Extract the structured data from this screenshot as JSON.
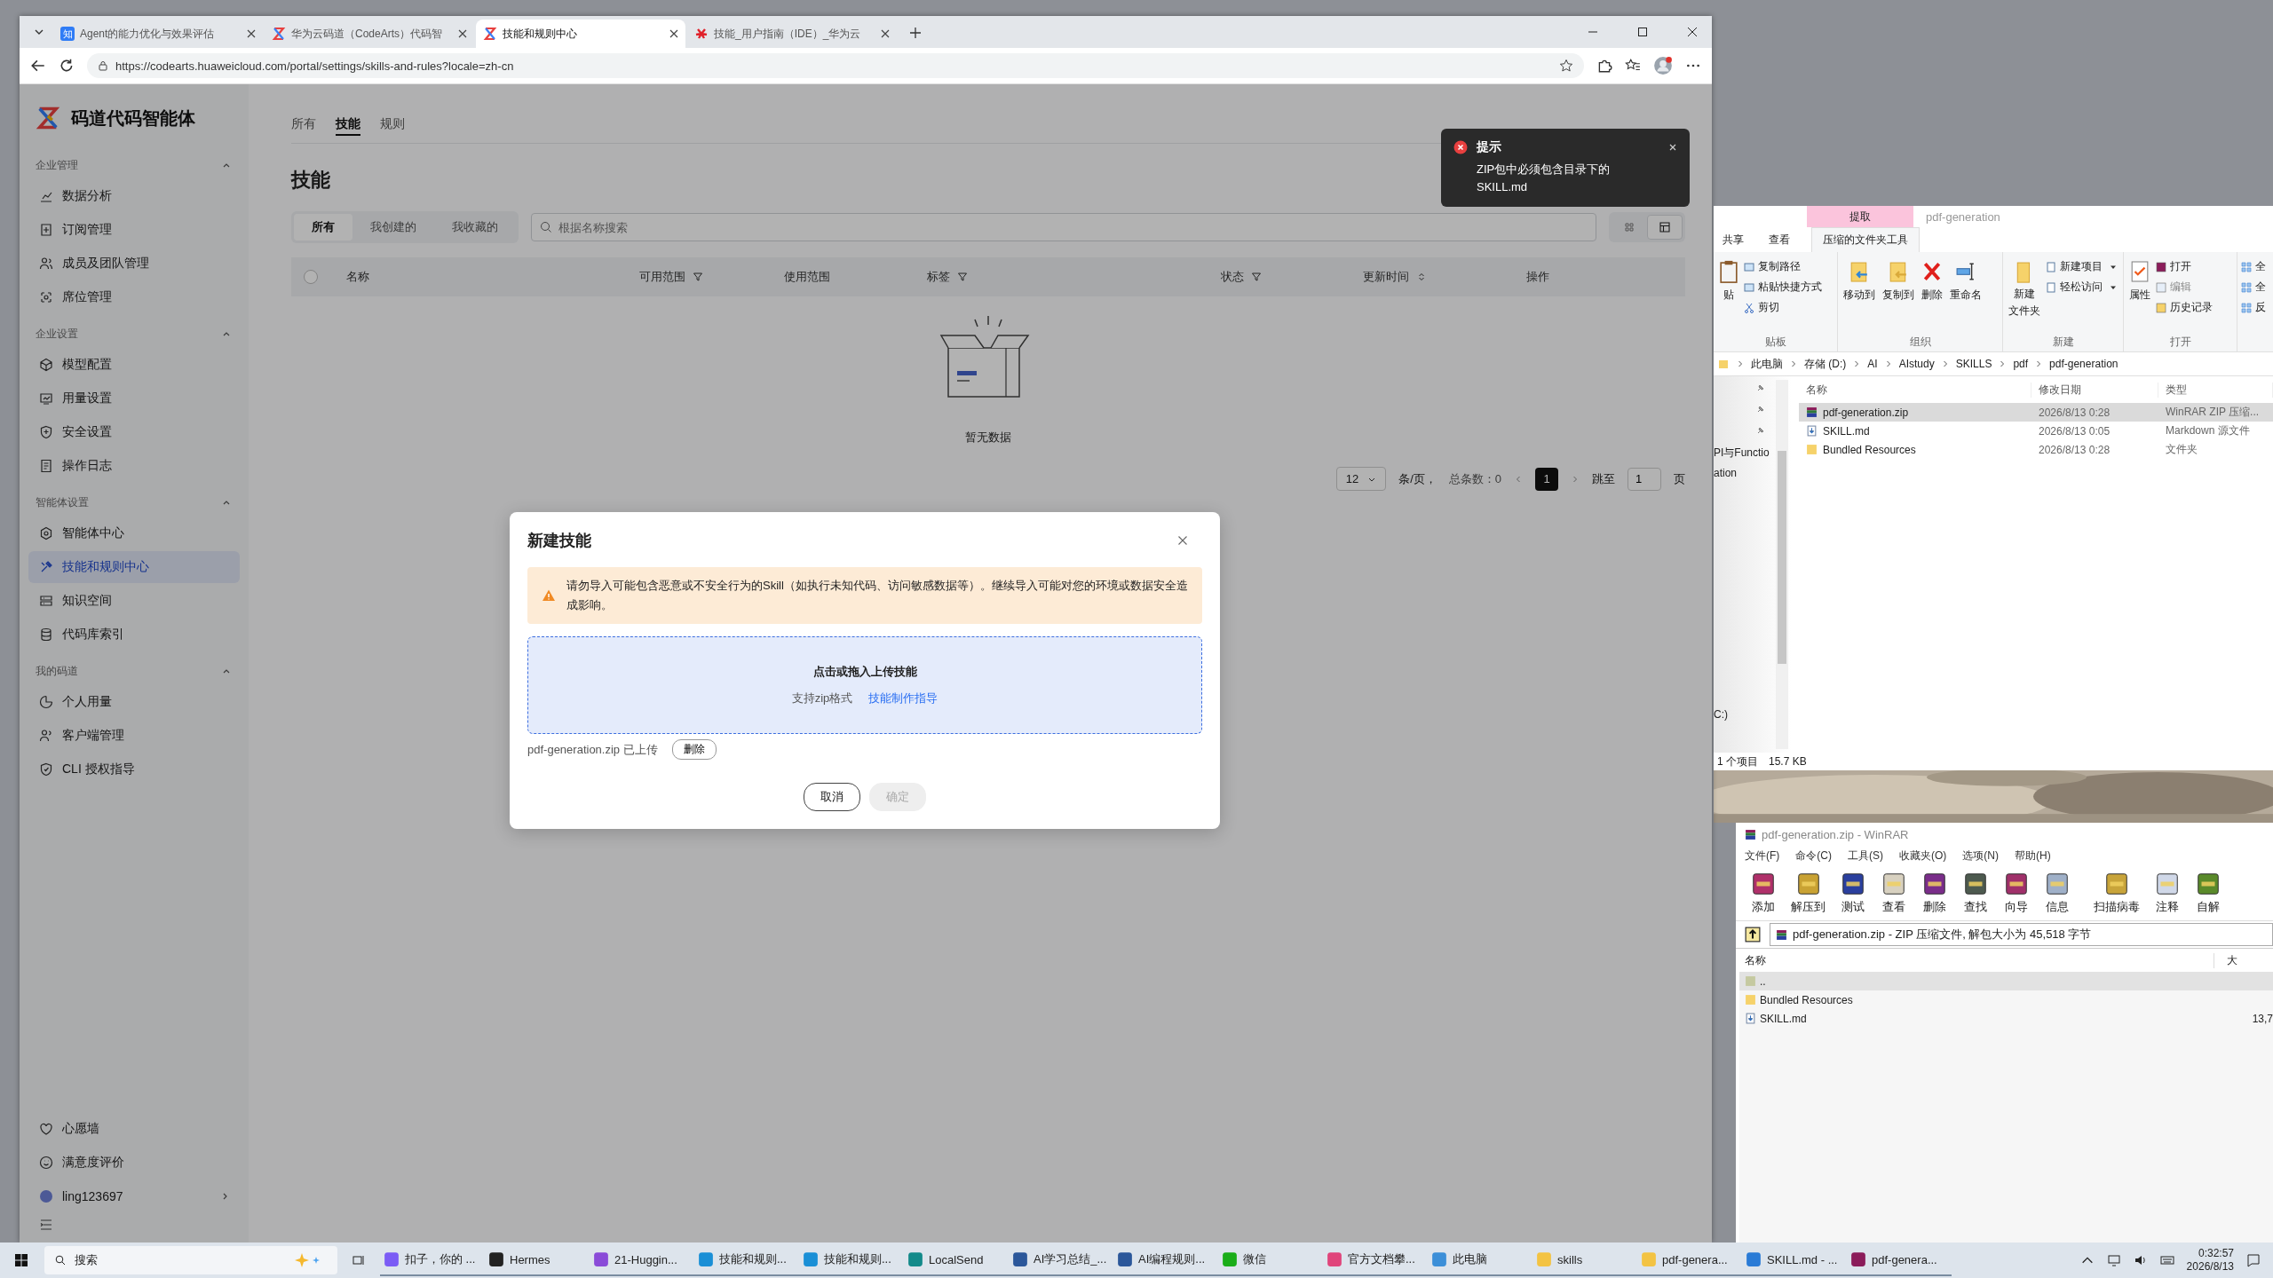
{
  "browser": {
    "tabs": [
      {
        "title": "Agent的能力优化与效果评估",
        "selected": false,
        "kind": "letter",
        "favicon_text": "知"
      },
      {
        "title": "华为云码道（CodeArts）代码智",
        "selected": false,
        "kind": "logo"
      },
      {
        "title": "技能和规则中心",
        "selected": true,
        "kind": "logo"
      },
      {
        "title": "技能_用户指南（IDE）_华为云",
        "selected": false,
        "kind": "flower"
      }
    ],
    "url": "https://codearts.huaweicloud.com/portal/settings/skills-and-rules?locale=zh-cn"
  },
  "sidebar": {
    "brand": "码道代码智能体",
    "sections": [
      {
        "title": "企业管理",
        "expanded": true,
        "items": [
          {
            "label": "数据分析",
            "selected": false
          },
          {
            "label": "订阅管理",
            "selected": false
          },
          {
            "label": "成员及团队管理",
            "selected": false
          },
          {
            "label": "席位管理",
            "selected": false
          }
        ]
      },
      {
        "title": "企业设置",
        "expanded": true,
        "items": [
          {
            "label": "模型配置",
            "selected": false
          },
          {
            "label": "用量设置",
            "selected": false
          },
          {
            "label": "安全设置",
            "selected": false
          },
          {
            "label": "操作日志",
            "selected": false
          }
        ]
      },
      {
        "title": "智能体设置",
        "expanded": true,
        "items": [
          {
            "label": "智能体中心",
            "selected": false
          },
          {
            "label": "技能和规则中心",
            "selected": true
          },
          {
            "label": "知识空间",
            "selected": false
          },
          {
            "label": "代码库索引",
            "selected": false
          }
        ]
      },
      {
        "title": "我的码道",
        "expanded": true,
        "items": [
          {
            "label": "个人用量",
            "selected": false
          },
          {
            "label": "客户端管理",
            "selected": false
          },
          {
            "label": "CLI 授权指导",
            "selected": false
          }
        ]
      }
    ],
    "bottom_items": [
      {
        "label": "心愿墙"
      },
      {
        "label": "满意度评价"
      }
    ],
    "user": {
      "name": "ling123697"
    }
  },
  "main": {
    "tabs": [
      {
        "label": "所有",
        "selected": false
      },
      {
        "label": "技能",
        "selected": true
      },
      {
        "label": "规则",
        "selected": false
      }
    ],
    "title": "技能",
    "filters": [
      {
        "label": "所有",
        "selected": true
      },
      {
        "label": "我创建的",
        "selected": false
      },
      {
        "label": "我收藏的",
        "selected": false
      }
    ],
    "search": {
      "placeholder": "根据名称搜索"
    },
    "view_toggle": [
      {
        "kind": "grid",
        "selected": false
      },
      {
        "kind": "table",
        "selected": true
      }
    ],
    "table": {
      "all_checked": false,
      "columns": [
        {
          "label": "名称",
          "kind": "plain"
        },
        {
          "label": "可用范围",
          "kind": "filter"
        },
        {
          "label": "使用范围",
          "kind": "plain"
        },
        {
          "label": "标签",
          "kind": "filter"
        },
        {
          "label": "状态",
          "kind": "filter"
        },
        {
          "label": "更新时间",
          "kind": "sort"
        },
        {
          "label": "操作",
          "kind": "plain"
        }
      ],
      "empty_text": "暂无数据"
    },
    "pagination": {
      "page_size": "12",
      "per_page_label": "条/页，",
      "total_label": "总条数：0",
      "pages": [
        {
          "label": "1",
          "selected": true
        }
      ],
      "jump_label": "跳至",
      "jump_value": "1",
      "page_unit": "页"
    }
  },
  "toast": {
    "kind": "error",
    "title": "提示",
    "message": "ZIP包中必须包含目录下的 SKILL.md"
  },
  "dialog": {
    "title": "新建技能",
    "warning": "请勿导入可能包含恶意或不安全行为的Skill（如执行未知代码、访问敏感数据等）。继续导入可能对您的环境或数据安全造成影响。",
    "upload": {
      "title": "点击或拖入上传技能",
      "hint": "支持zip格式",
      "link": "技能制作指导"
    },
    "file": {
      "name": "pdf-generation.zip 已上传",
      "action": "删除"
    },
    "buttons": [
      {
        "label": "取消",
        "disabled": false
      },
      {
        "label": "确定",
        "disabled": true
      }
    ]
  },
  "explorer": {
    "context_tab": "提取",
    "title": "pdf-generation",
    "tabs": [
      {
        "label": "共享",
        "selected": false
      },
      {
        "label": "查看",
        "selected": false
      },
      {
        "label": "压缩的文件夹工具",
        "selected": true
      }
    ],
    "clipboard": {
      "paste": "贴",
      "items": [
        "复制路径",
        "粘贴快捷方式"
      ],
      "cut": "剪切",
      "label": "贴板"
    },
    "organize": {
      "buttons": [
        "移动到",
        "复制到",
        "删除",
        "重命名"
      ],
      "label": "组织"
    },
    "new": {
      "folder_lines": [
        "新建",
        "文件夹"
      ],
      "items": [
        "新建项目",
        "轻松访问"
      ],
      "label": "新建"
    },
    "open": {
      "properties": "属性",
      "items": [
        "打开",
        "编辑",
        "历史记录"
      ],
      "label": "打开"
    },
    "select": {
      "items": [
        "全",
        "全",
        "反"
      ]
    },
    "breadcrumb": [
      "此电脑",
      "存储 (D:)",
      "AI",
      "AIstudy",
      "SKILLS",
      "pdf",
      "pdf-generation"
    ],
    "nav": [
      "PI与Functio",
      "ation",
      "C:)"
    ],
    "columns": [
      "名称",
      "修改日期",
      "类型"
    ],
    "rows": [
      {
        "name": "pdf-generation.zip",
        "date": "2026/8/13 0:28",
        "type": "WinRAR ZIP 压缩...",
        "kind": "zip",
        "selected": true
      },
      {
        "name": "SKILL.md",
        "date": "2026/8/13 0:05",
        "type": "Markdown 源文件",
        "kind": "file",
        "selected": false
      },
      {
        "name": "Bundled Resources",
        "date": "2026/8/13 0:28",
        "type": "文件夹",
        "kind": "folder",
        "selected": false
      }
    ],
    "status": [
      "1 个项目",
      "15.7 KB"
    ]
  },
  "winrar": {
    "title": "pdf-generation.zip - WinRAR",
    "menus": [
      "文件(F)",
      "命令(C)",
      "工具(S)",
      "收藏夹(O)",
      "选项(N)",
      "帮助(H)"
    ],
    "tools": [
      "添加",
      "解压到",
      "测试",
      "查看",
      "删除",
      "查找",
      "向导",
      "信息",
      "扫描病毒",
      "注释",
      "自解"
    ],
    "path": "pdf-generation.zip - ZIP 压缩文件, 解包大小为 45,518 字节",
    "columns": [
      "名称",
      "大"
    ],
    "rows": [
      {
        "name": "..",
        "size": "",
        "kind": "up",
        "selected": true
      },
      {
        "name": "Bundled Resources",
        "size": "",
        "kind": "folder",
        "selected": false
      },
      {
        "name": "SKILL.md",
        "size": "13,7",
        "kind": "file",
        "selected": false
      }
    ]
  },
  "taskbar": {
    "search": "搜索",
    "apps": [
      {
        "label": "扣子，你的 ...",
        "color": "#7b5cf5"
      },
      {
        "label": "Hermes",
        "color": "#222222"
      },
      {
        "label": "21-Huggin...",
        "color": "#8a4bd8"
      },
      {
        "label": "技能和规则...",
        "color": "#1a8fd6"
      },
      {
        "label": "技能和规则...",
        "color": "#1a8fd6"
      },
      {
        "label": "LocalSend",
        "color": "#138a8a"
      },
      {
        "label": "AI学习总结_...",
        "color": "#2b579a"
      },
      {
        "label": "AI编程规则...",
        "color": "#2b579a"
      },
      {
        "label": "微信",
        "color": "#1aad19"
      },
      {
        "label": "官方文档攀...",
        "color": "#e0457b"
      },
      {
        "label": "此电脑",
        "color": "#3c8fd8"
      },
      {
        "label": "skills",
        "color": "#f3c343"
      },
      {
        "label": "pdf-genera...",
        "color": "#f3c343"
      },
      {
        "label": "SKILL.md - ...",
        "color": "#2a7bd6"
      },
      {
        "label": "pdf-genera...",
        "color": "#8b1c5a"
      }
    ],
    "time": "0:32:57",
    "date": "2026/8/13"
  }
}
